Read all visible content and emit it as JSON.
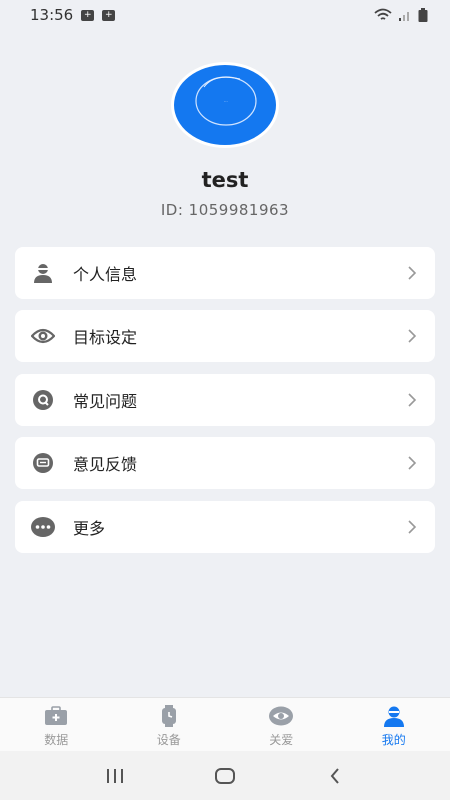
{
  "status_bar": {
    "time": "13:56"
  },
  "profile": {
    "username": "test",
    "user_id": "ID: 1059981963",
    "avatar_color": "#1478f0"
  },
  "menu": {
    "items": [
      {
        "label": "个人信息",
        "icon": "person-icon"
      },
      {
        "label": "目标设定",
        "icon": "target-eye-icon"
      },
      {
        "label": "常见问题",
        "icon": "faq-icon"
      },
      {
        "label": "意见反馈",
        "icon": "feedback-message-icon"
      },
      {
        "label": "更多",
        "icon": "more-dots-icon"
      }
    ]
  },
  "tab_bar": {
    "active_color": "#1478f0",
    "inactive_color": "#999999",
    "tabs": [
      {
        "label": "数据",
        "icon": "medical-kit-icon",
        "active": false
      },
      {
        "label": "设备",
        "icon": "watch-icon",
        "active": false
      },
      {
        "label": "关爱",
        "icon": "care-eye-icon",
        "active": false
      },
      {
        "label": "我的",
        "icon": "profile-icon",
        "active": true
      }
    ]
  }
}
